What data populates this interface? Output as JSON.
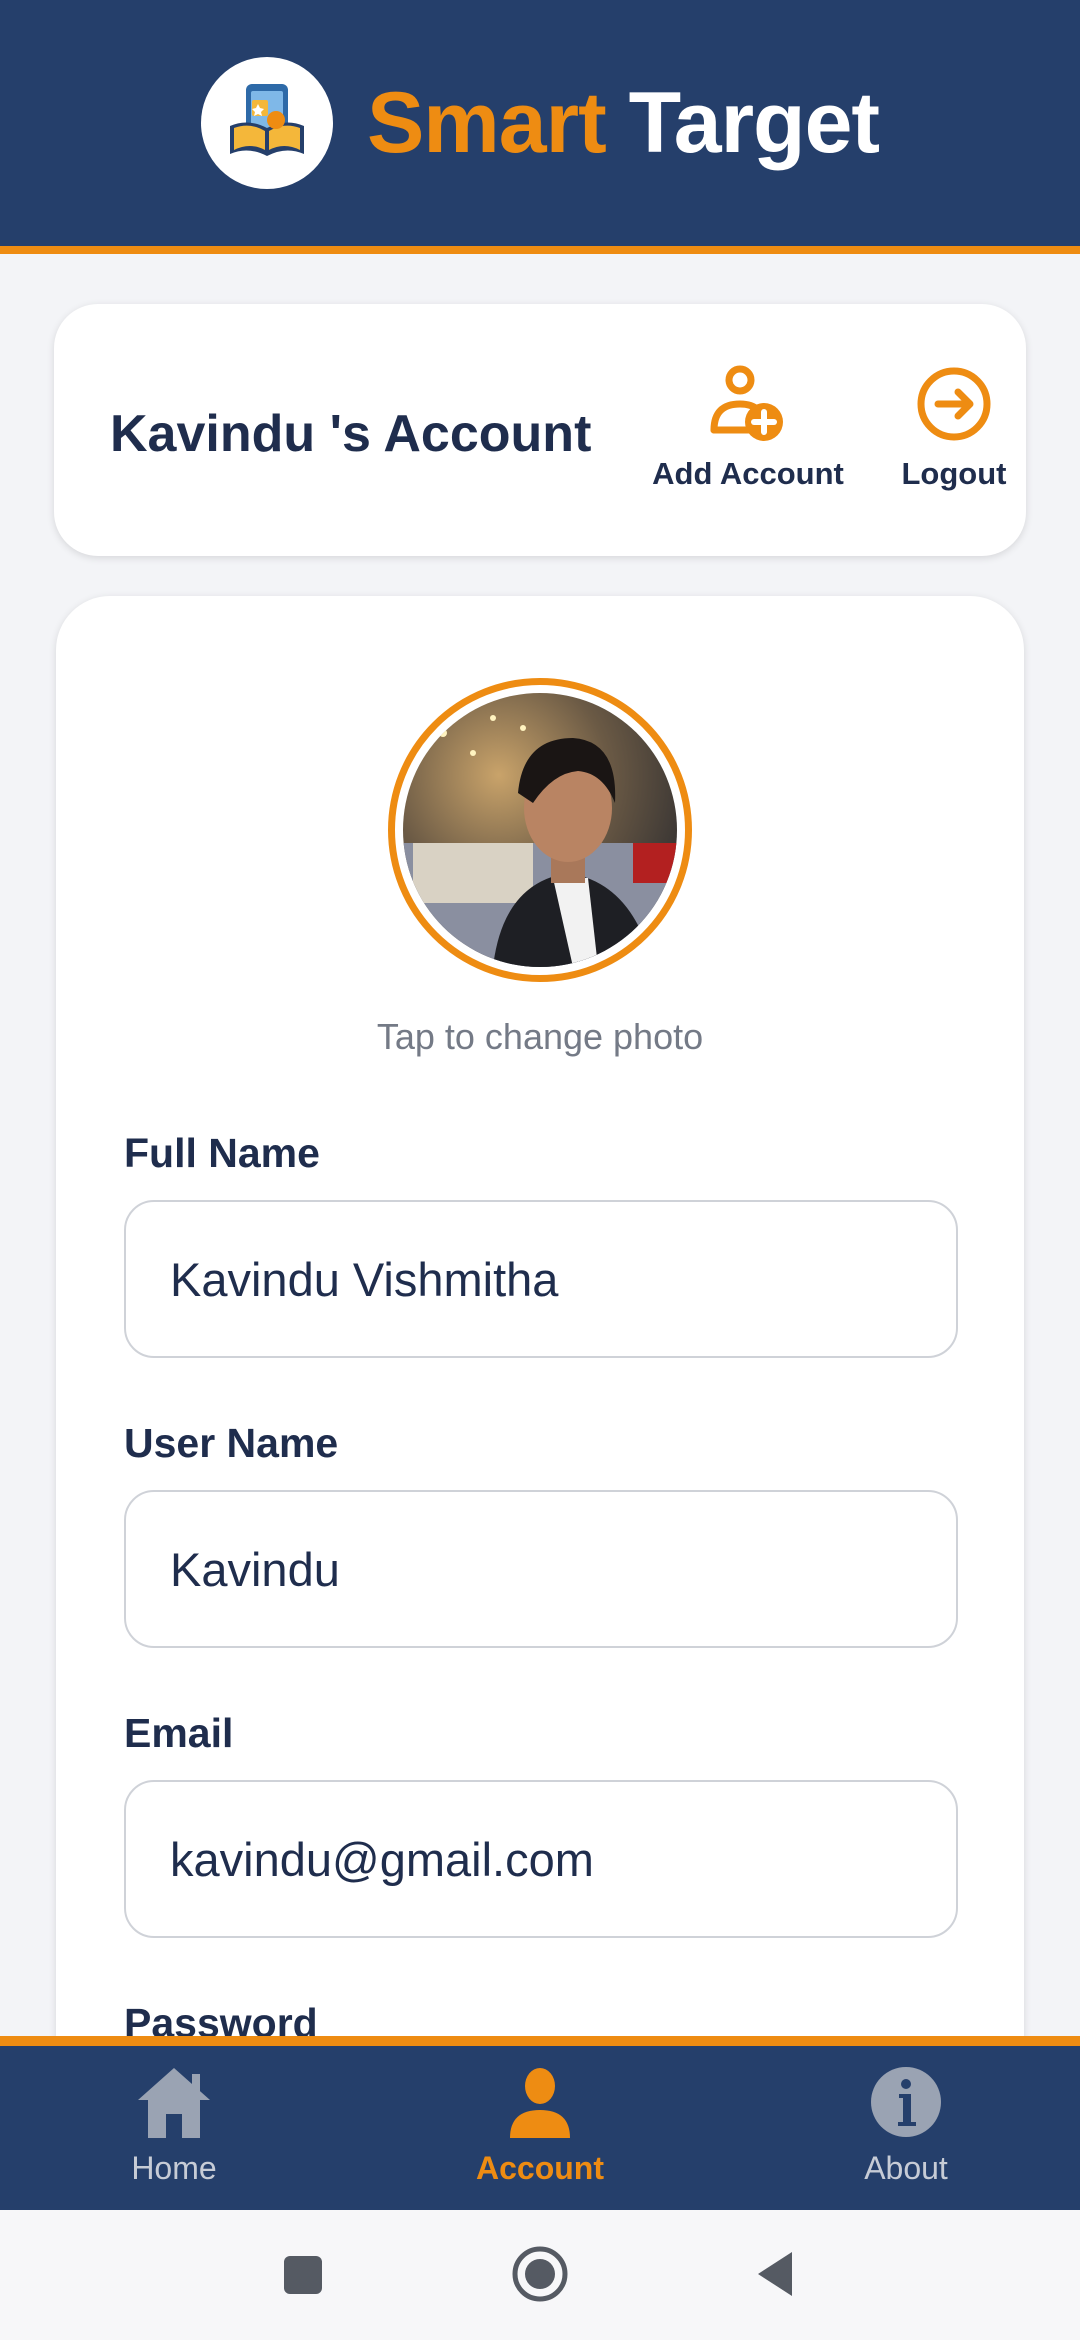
{
  "header": {
    "brand_part1": "Smart",
    "brand_part2": "Target",
    "logo_icon": "book-phone-logo-icon"
  },
  "account_card": {
    "title": "Kavindu 's Account",
    "add_account_label": "Add Account",
    "logout_label": "Logout"
  },
  "profile": {
    "tap_photo_text": "Tap to change photo",
    "fields": [
      {
        "label": "Full Name",
        "value": "Kavindu Vishmitha"
      },
      {
        "label": "User Name",
        "value": "Kavindu"
      },
      {
        "label": "Email",
        "value": "kavindu@gmail.com"
      },
      {
        "label": "Password",
        "value": ""
      }
    ]
  },
  "bottom_nav": {
    "items": [
      {
        "label": "Home",
        "icon": "home-icon",
        "active": false
      },
      {
        "label": "Account",
        "icon": "person-icon",
        "active": true
      },
      {
        "label": "About",
        "icon": "info-icon",
        "active": false
      }
    ]
  },
  "colors": {
    "primary": "#253f6b",
    "accent": "#ee8c12",
    "text": "#1f2d4d",
    "background": "#f3f4f7"
  }
}
